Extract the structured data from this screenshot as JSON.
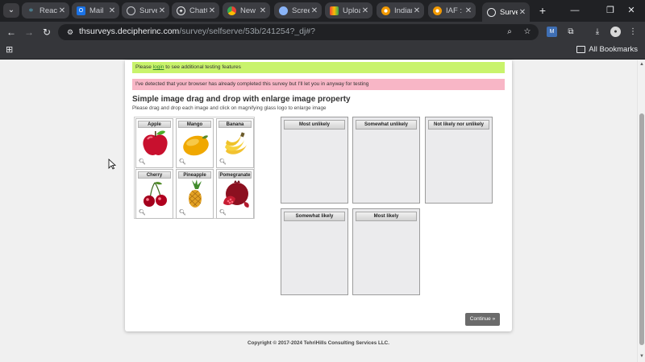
{
  "browser": {
    "tabs": [
      {
        "label": "React",
        "icon": "react-icon",
        "color": "#61dafb"
      },
      {
        "label": "Mail",
        "icon": "outlook-icon",
        "color": "#1a73e8"
      },
      {
        "label": "Surve",
        "icon": "globe-icon",
        "color": "#9aa0a6"
      },
      {
        "label": "ChatG",
        "icon": "chatgpt-icon",
        "color": "#e8eaed"
      },
      {
        "label": "New I",
        "icon": "chrome-icon",
        "color": "#fbbc04"
      },
      {
        "label": "Screen",
        "icon": "screencast-icon",
        "color": "#8ab4f8"
      },
      {
        "label": "Uploa",
        "icon": "upload-icon",
        "color": "#34a853"
      },
      {
        "label": "Indian",
        "icon": "indian-icon",
        "color": "#f29900"
      },
      {
        "label": "IAF : I",
        "icon": "iaf-icon",
        "color": "#f29900"
      },
      {
        "label": "Surve",
        "icon": "globe-icon",
        "color": "#9aa0a6",
        "active": true
      }
    ],
    "url_host": "thsurveys.decipherinc.com",
    "url_path": "/survey/selfserve/53b/241254?_dj#?",
    "bookmarks_label": "All Bookmarks"
  },
  "notices": {
    "login_prefix": "Please ",
    "login_link": "login",
    "login_suffix": " to see additional testing features",
    "completed": "I've detected that your browser has already completed this survey but I'll let you in anyway for testing"
  },
  "question": {
    "title": "Simple image drag and drop with enlarge image property",
    "instruction": "Please drag and drop each image and click on magnifying glass logo to enlarge image"
  },
  "items": [
    {
      "label": "Apple",
      "fruit": "apple"
    },
    {
      "label": "Mango",
      "fruit": "mango"
    },
    {
      "label": "Banana",
      "fruit": "banana"
    },
    {
      "label": "Cherry",
      "fruit": "cherry"
    },
    {
      "label": "Pineapple",
      "fruit": "pineapple"
    },
    {
      "label": "Pomegranate",
      "fruit": "pomegranate"
    }
  ],
  "buckets": [
    {
      "label": "Most unlikely"
    },
    {
      "label": "Somewhat unlikely"
    },
    {
      "label": "Not likely nor unlikely"
    },
    {
      "label": "Somewhat likely"
    },
    {
      "label": "Most likely"
    }
  ],
  "continue_label": "Continue »",
  "footer": "Copyright © 2017-2024 TehriHills Consulting Services LLC."
}
